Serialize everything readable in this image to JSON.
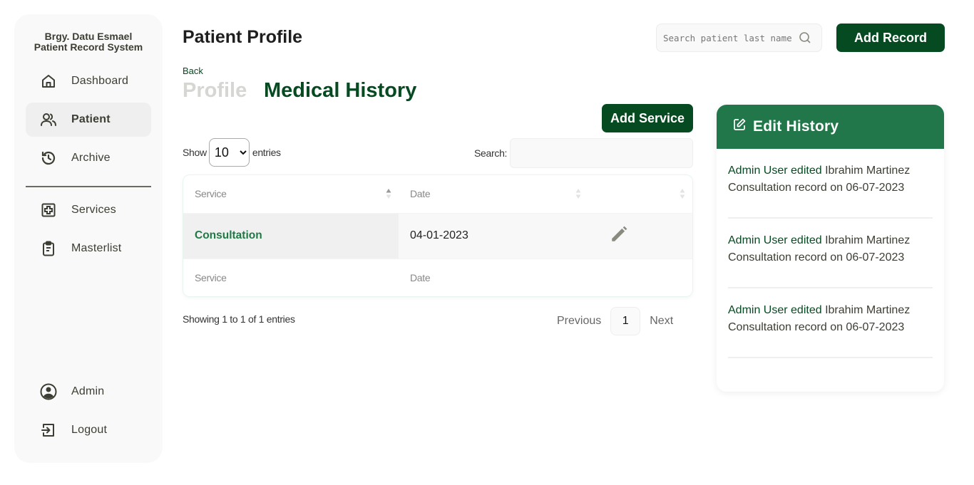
{
  "sidebar": {
    "brand_line1": "Brgy. Datu Esmael",
    "brand_line2": "Patient Record System",
    "items": [
      {
        "label": "Dashboard",
        "icon": "home-icon"
      },
      {
        "label": "Patient",
        "icon": "users-icon",
        "active": true
      },
      {
        "label": "Archive",
        "icon": "history-icon"
      },
      {
        "label": "Services",
        "icon": "medical-plus-icon"
      },
      {
        "label": "Masterlist",
        "icon": "clipboard-icon"
      }
    ],
    "bottom_items": [
      {
        "label": "Admin",
        "icon": "user-circle-icon"
      },
      {
        "label": "Logout",
        "icon": "logout-icon"
      }
    ]
  },
  "header": {
    "title": "Patient Profile",
    "search_placeholder": "Search patient last name",
    "add_record_label": "Add Record"
  },
  "nav": {
    "back_label": "Back",
    "tabs": [
      {
        "label": "Profile",
        "active": false
      },
      {
        "label": "Medical History",
        "active": true
      }
    ]
  },
  "table_controls": {
    "add_service_label": "Add Service",
    "show_label": "Show",
    "entries_value": "10",
    "entries_label": "entries",
    "search_label": "Search:"
  },
  "table": {
    "columns": [
      "Service",
      "Date",
      ""
    ],
    "rows": [
      {
        "service": "Consultation",
        "date": "04-01-2023"
      }
    ],
    "footer_columns": [
      "Service",
      "Date",
      ""
    ],
    "info": "Showing 1 to 1 of 1 entries",
    "pagination": {
      "previous": "Previous",
      "current": "1",
      "next": "Next"
    }
  },
  "edit_history": {
    "title": "Edit History",
    "items": [
      {
        "actor": "Admin User edited",
        "patient": "Ibrahim Martinez",
        "detail": "Consultation record on 06-07-2023"
      },
      {
        "actor": "Admin User edited",
        "patient": "Ibrahim Martinez",
        "detail": "Consultation record on 06-07-2023"
      },
      {
        "actor": "Admin User edited",
        "patient": "Ibrahim Martinez",
        "detail": "Consultation record on 06-07-2023"
      }
    ]
  },
  "colors": {
    "brand_dark_green": "#064a22",
    "header_green": "#22774a",
    "service_green": "#1e7a45",
    "text_dark": "#3d3d33"
  }
}
